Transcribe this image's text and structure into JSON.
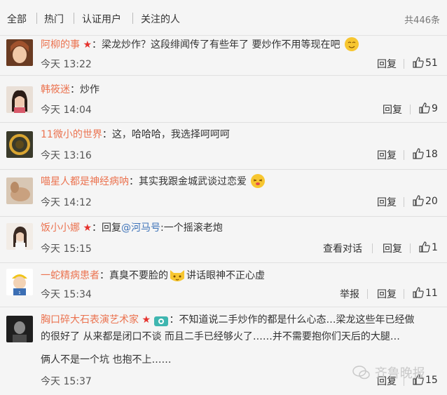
{
  "tabs": [
    "全部",
    "热门",
    "认证用户",
    "关注的人"
  ],
  "total": "共446条",
  "comments": [
    {
      "user": "阿柳的事",
      "sep": "：",
      "text": "梁龙炒作？这段绯闻传了有些年了 要炒作不用等现在吧",
      "time": "今天 13:22",
      "reply": "回复",
      "likes": "51"
    },
    {
      "user": "韩筱迷",
      "sep": "：",
      "text": "炒作",
      "time": "今天 14:04",
      "reply": "回复",
      "likes": "9"
    },
    {
      "user": "11微小的世界",
      "sep": "：",
      "text": "这，哈哈哈，我选择呵呵呵",
      "time": "今天 13:16",
      "reply": "回复",
      "likes": "18"
    },
    {
      "user": "喵星人都是神经病呐",
      "sep": "：",
      "text": "其实我跟金城武谈过恋爱",
      "time": "今天 14:12",
      "reply": "回复",
      "likes": "20"
    },
    {
      "user": "饭小小娜",
      "sep": "：",
      "reply_prefix": "回复",
      "mention": "@河马号",
      "text": ":一个摇滚老炮",
      "time": "今天 15:15",
      "convo": "查看对话",
      "reply": "回复",
      "likes": "1"
    },
    {
      "user": "一蛇精病患者",
      "sep": "：",
      "text": "真臭不要脸的",
      "text2": "讲话眼神不正心虚",
      "time": "今天 15:34",
      "report": "举报",
      "reply": "回复",
      "likes": "11"
    },
    {
      "user": "胸口碎大石表演艺术家",
      "sep": "：",
      "text": "不知道说二手炒作的都是什么心态…梁龙这些年已经做",
      "line2": "的很好了 从来都是闭口不谈 而且二手已经够火了……并不需要抱你们天后的大腿…",
      "line3": "俩人不是一个坑 也抱不上……",
      "time": "今天 15:37",
      "reply": "回复",
      "likes": "15"
    }
  ],
  "watermark": "齐鲁晚报",
  "colors": {
    "username": "#eb7350",
    "mention": "#3f74b9",
    "star": "#e5322d"
  }
}
